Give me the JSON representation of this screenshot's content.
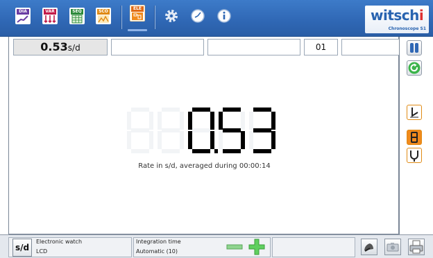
{
  "toolbar": {
    "buttons": [
      {
        "id": "dia",
        "tag": "DIA",
        "tag_color": "#6a3ca3"
      },
      {
        "id": "var",
        "tag": "VAR",
        "tag_color": "#c21c4a"
      },
      {
        "id": "seq",
        "tag": "SEQ",
        "tag_color": "#2d8a3a"
      },
      {
        "id": "sco",
        "tag": "SCO",
        "tag_color": "#e08a14"
      },
      {
        "id": "ele",
        "tag": "ELE",
        "tag_color": "#e06a14"
      }
    ],
    "icons": [
      "gear-icon",
      "clock-icon",
      "info-icon"
    ]
  },
  "brand": {
    "logo_main": "witsch",
    "logo_last": "i",
    "subtitle": "Chronoscope S1"
  },
  "fields": {
    "rate_value": "0.53",
    "rate_unit": "s/d",
    "field_2": "",
    "field_3": "",
    "field_4": "01",
    "field_5": ""
  },
  "display": {
    "value": "0.53",
    "caption": "Rate in s/d, averaged during 00:00:14"
  },
  "side_panel": {
    "buttons": [
      "pause-icon",
      "refresh-icon",
      "position-icon",
      "digit-eight-icon",
      "tuning-fork-icon"
    ]
  },
  "statusbar": {
    "unit_button": "s/d",
    "watch_type_label": "Electronic watch",
    "watch_type_value": "LCD",
    "integration_label": "Integration time",
    "integration_value": "Automatic (10)"
  },
  "colors": {
    "toolbar_blue": "#2f67b4",
    "accent_orange": "#f08a1c",
    "green_plus": "#3cb44b"
  }
}
